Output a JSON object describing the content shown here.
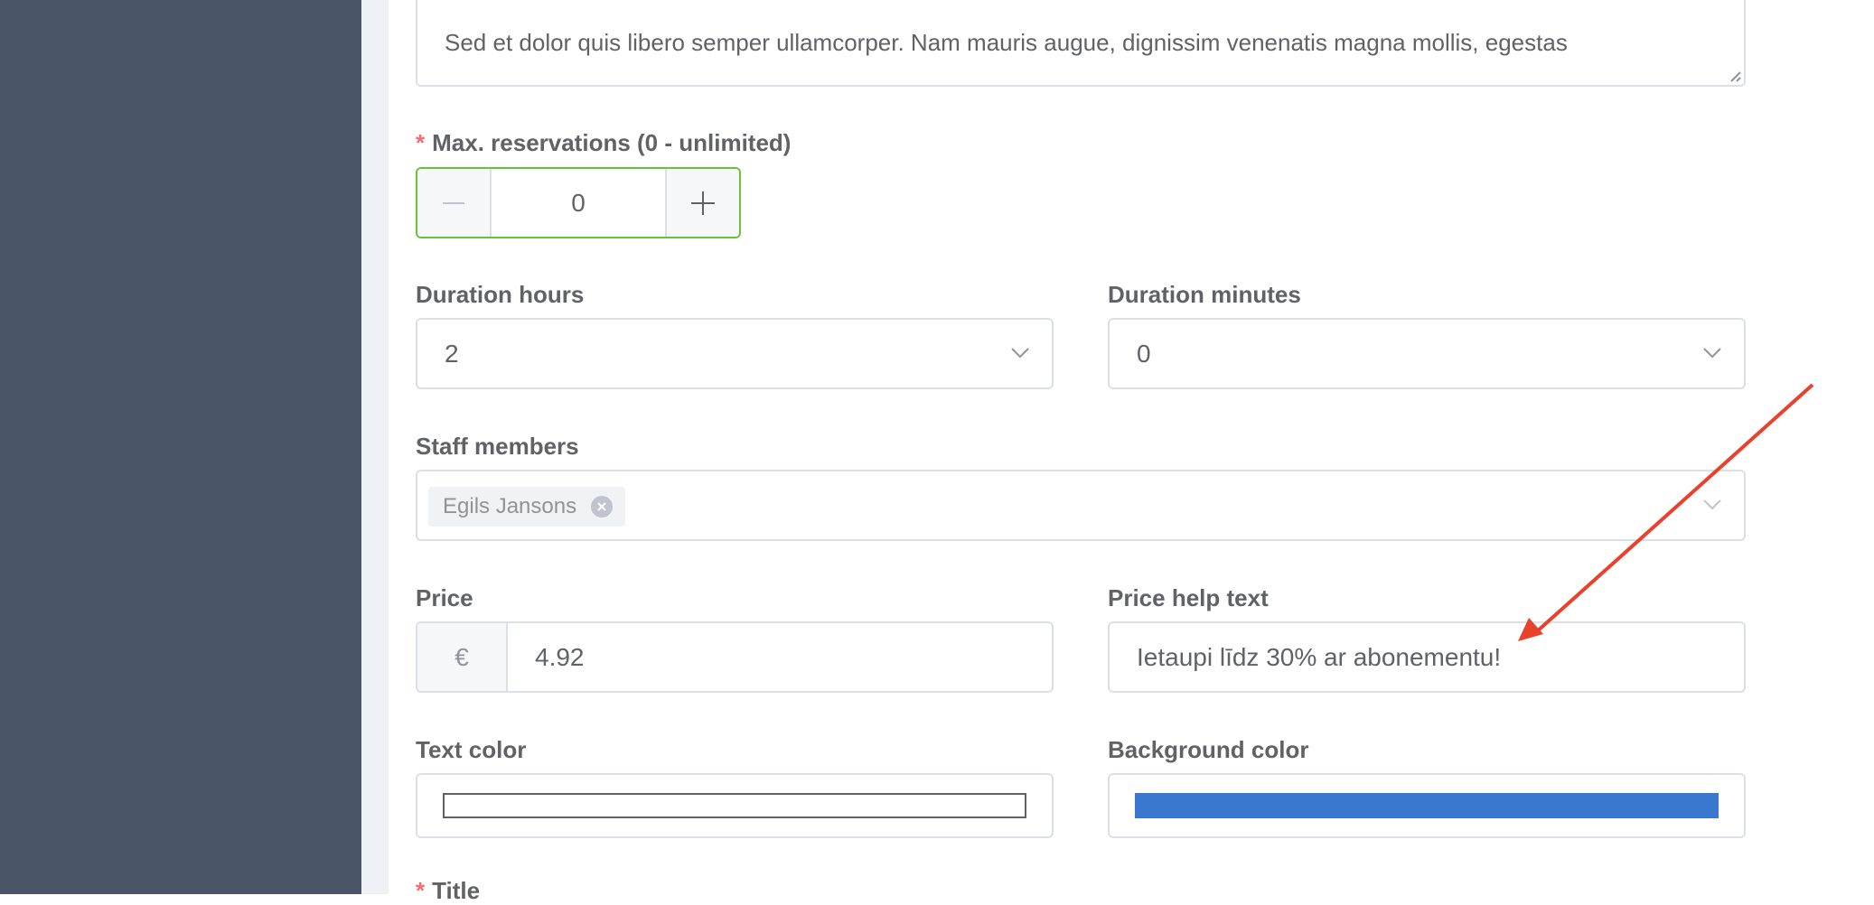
{
  "description_field": {
    "visible_text": "Sed et dolor quis libero semper ullamcorper. Nam mauris augue, dignissim venenatis magna mollis, egestas"
  },
  "max_reservations": {
    "required_mark": "*",
    "label": "Max. reservations (0 - unlimited)",
    "value": "0",
    "minus_symbol": "—",
    "plus_symbol": "+"
  },
  "duration_hours": {
    "label": "Duration hours",
    "value": "2"
  },
  "duration_minutes": {
    "label": "Duration minutes",
    "value": "0"
  },
  "staff_members": {
    "label": "Staff members",
    "selected": [
      "Egils Jansons"
    ]
  },
  "price": {
    "label": "Price",
    "currency_symbol": "€",
    "value": "4.92"
  },
  "price_help_text": {
    "label": "Price help text",
    "value": "Ietaupi līdz 30% ar abonementu!"
  },
  "text_color": {
    "label": "Text color",
    "color": "#ffffff"
  },
  "background_color": {
    "label": "Background color",
    "color": "#3a78d0"
  },
  "title_field": {
    "required_mark": "*",
    "label": "Title"
  },
  "colors": {
    "sidebar": "#4a5568",
    "gutter": "#eef1f6",
    "focus_green": "#67c23a",
    "annotation_arrow": "#e8412c"
  }
}
